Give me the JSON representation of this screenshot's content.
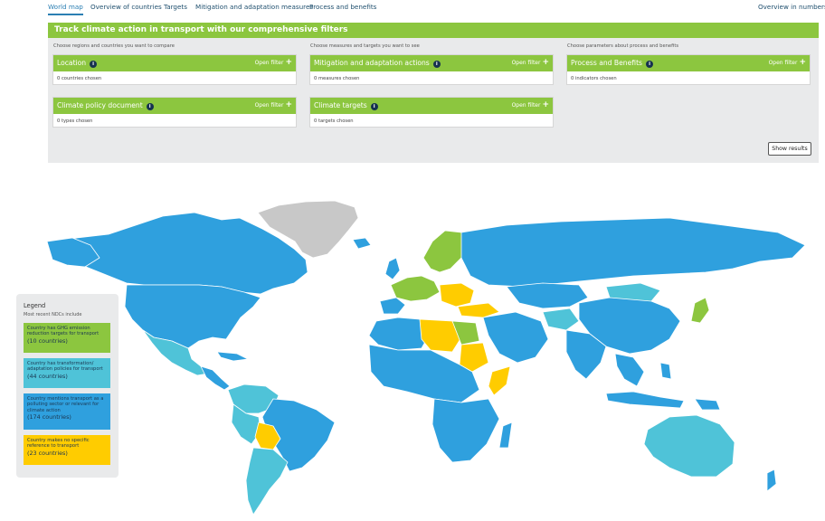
{
  "nav": {
    "tabs": [
      "World map",
      "Overview of countries",
      "Targets",
      "Mitigation and adaptation measures",
      "Process and benefits"
    ],
    "right_link": "Overview in numbers"
  },
  "filters": {
    "title": "Track climate action in transport with our comprehensive filters",
    "columns": [
      "Choose regions and countries you want to compare",
      "Choose measures and targets you want to see",
      "Choose parameters about process and benefits"
    ],
    "cards": [
      {
        "title": "Location",
        "count": "0 countries chosen"
      },
      {
        "title": "Climate policy document",
        "count": "0 types chosen"
      },
      {
        "title": "Mitigation and adaptation actions",
        "count": "0 measures chosen"
      },
      {
        "title": "Climate targets",
        "count": "0 targets chosen"
      },
      {
        "title": "Process and Benefits",
        "count": "0 indicators chosen"
      }
    ],
    "open_label": "Open filter",
    "show_results": "Show results"
  },
  "legend": {
    "title": "Legend",
    "subtitle": "Most recent NDCs include",
    "items": [
      {
        "text": "Country has GHG emission reduction targets for transport",
        "count": "(10 countries)",
        "color": "#8cc63f"
      },
      {
        "text": "Country has transformation/ adaptation policies for transport",
        "count": "(44 countries)",
        "color": "#4fc3d8"
      },
      {
        "text": "Country mentions transport as a polluting sector or relevant for climate action",
        "count": "(174 countries)",
        "color": "#2fa0de"
      },
      {
        "text": "Country makes no specific reference to transport",
        "count": "(23 countries)",
        "color": "#ffcc00"
      }
    ]
  },
  "colors": {
    "accent_green": "#8cc63f",
    "nav_blue": "#2b7fb3",
    "map_no_data": "#c8c8c8"
  }
}
